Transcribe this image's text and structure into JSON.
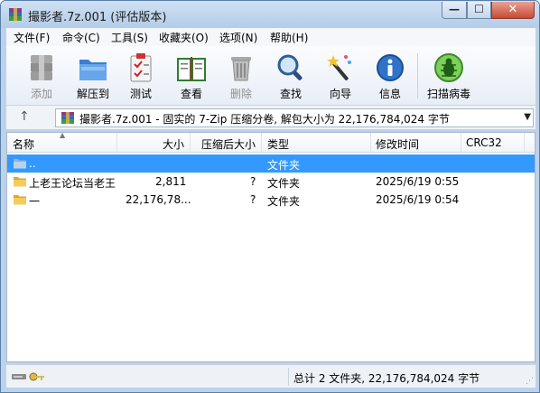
{
  "window": {
    "title": "撮影者.7z.001 (评估版本)",
    "min_glyph": "—",
    "max_glyph": "☐",
    "close_glyph": "✕"
  },
  "menu": [
    "文件(F)",
    "命令(C)",
    "工具(S)",
    "收藏夹(O)",
    "选项(N)",
    "帮助(H)"
  ],
  "toolbar": [
    {
      "label": "添加",
      "icon": "archive-add-icon",
      "disabled": true
    },
    {
      "label": "解压到",
      "icon": "folder-extract-icon",
      "disabled": false
    },
    {
      "label": "测试",
      "icon": "checklist-icon",
      "disabled": false
    },
    {
      "label": "查看",
      "icon": "open-book-icon",
      "disabled": false
    },
    {
      "label": "删除",
      "icon": "trash-bin-icon",
      "disabled": true
    },
    {
      "label": "查找",
      "icon": "magnifier-icon",
      "disabled": false
    },
    {
      "label": "向导",
      "icon": "magic-wand-icon",
      "disabled": false
    },
    {
      "label": "信息",
      "icon": "info-icon",
      "disabled": false
    },
    {
      "label": "扫描病毒",
      "icon": "bug-scan-icon",
      "disabled": false
    }
  ],
  "address": {
    "text": "撮影者.7z.001 - 固实的 7-Zip 压缩分卷, 解包大小为 22,176,784,024 字节"
  },
  "columns": {
    "name": "名称",
    "size": "大小",
    "packed": "压缩后大小",
    "type": "类型",
    "modified": "修改时间",
    "crc": "CRC32"
  },
  "rows": [
    {
      "name": "..",
      "size": "",
      "packed": "",
      "type": "文件夹",
      "modified": "",
      "crc": "",
      "selected": true
    },
    {
      "name": "上老王论坛当老王",
      "size": "2,811",
      "packed": "?",
      "type": "文件夹",
      "modified": "2025/6/19 0:55",
      "crc": "",
      "selected": false
    },
    {
      "name": "一",
      "size": "22,176,78...",
      "packed": "?",
      "type": "文件夹",
      "modified": "2025/6/19 0:54",
      "crc": "",
      "selected": false
    }
  ],
  "status": {
    "summary": "总计 2 文件夹, 22,176,784,024 字节"
  },
  "colors": {
    "selection": "#3399ff",
    "chrome": "#bcd2ea",
    "close_button": "#c74a34"
  }
}
